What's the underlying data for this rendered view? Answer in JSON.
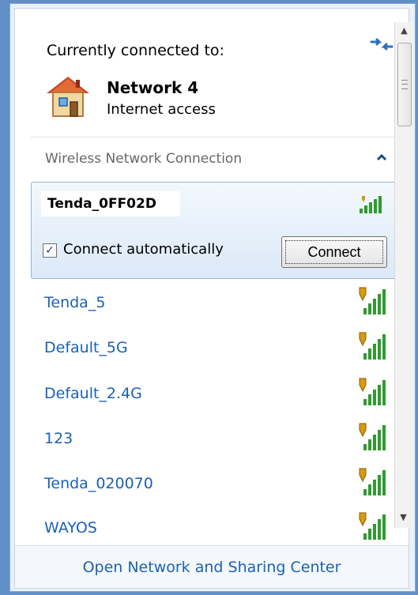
{
  "header": {
    "title": "Currently connected to:",
    "refresh_icon": "refresh-icon"
  },
  "current_network": {
    "name": "Network  4",
    "status": "Internet access",
    "icon": "house-icon"
  },
  "section": {
    "title": "Wireless Network Connection",
    "toggle_icon": "chevron-up-icon"
  },
  "selected_network": {
    "name": "Tenda_0FF02D",
    "connect_automatically_label": "Connect automatically",
    "connect_automatically_checked": true,
    "connect_button_label": "Connect",
    "signal_icon": "wifi-signal-icon"
  },
  "networks": [
    {
      "name": "Tenda_5",
      "icon": "secured-wifi-signal-icon"
    },
    {
      "name": "Default_5G",
      "icon": "secured-wifi-signal-icon"
    },
    {
      "name": "Default_2.4G",
      "icon": "secured-wifi-signal-icon"
    },
    {
      "name": "123",
      "icon": "secured-wifi-signal-icon"
    },
    {
      "name": "Tenda_020070",
      "icon": "secured-wifi-signal-icon"
    },
    {
      "name": "WAYOS",
      "icon": "secured-wifi-signal-icon"
    }
  ],
  "footer": {
    "link": "Open Network and Sharing Center"
  },
  "colors": {
    "link": "#1a61b6",
    "panel_border": "#8fb6dd",
    "signal_green": "#2f9b2f",
    "signal_dark": "#2b6f2b",
    "shield_gold": "#d69b12"
  }
}
